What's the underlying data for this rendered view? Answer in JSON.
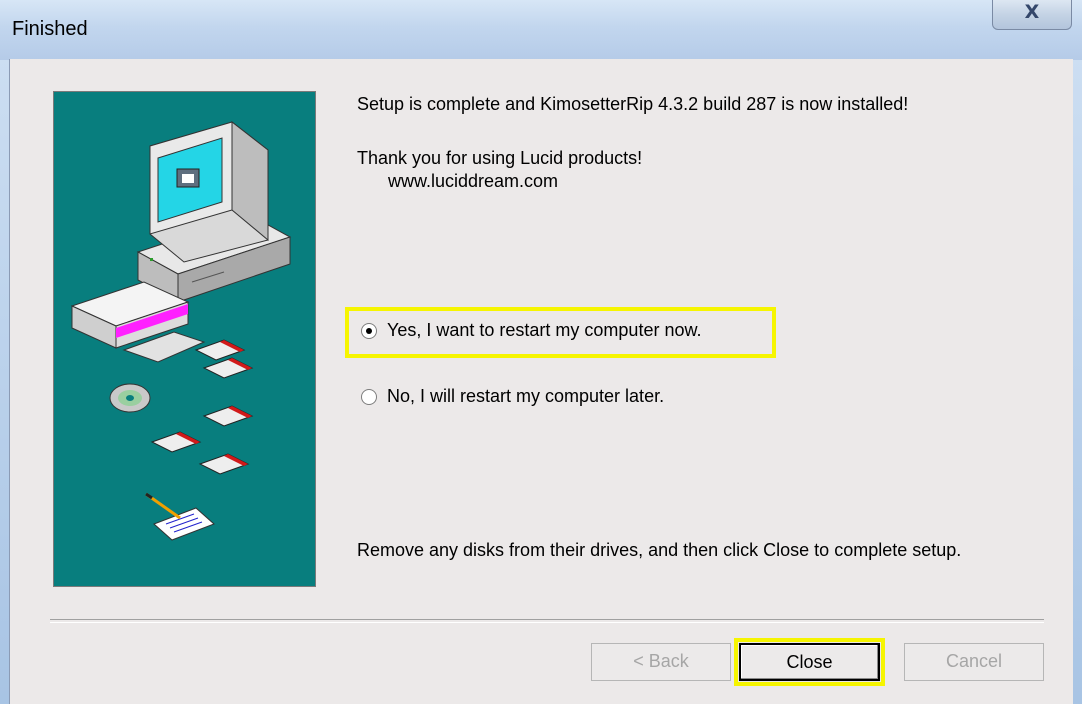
{
  "window": {
    "title": "Finished",
    "close_glyph": "X"
  },
  "content": {
    "line1": "Setup is complete and KimosetterRip 4.3.2 build 287 is now installed!",
    "line2": "Thank you for using Lucid products!",
    "line3": "www.luciddream.com",
    "radio_yes": "Yes, I want to restart my computer now.",
    "radio_no": "No, I will restart my computer later.",
    "radio_selected": "yes",
    "instructions": "Remove any disks from their drives, and then click Close to complete setup."
  },
  "buttons": {
    "back": "< Back",
    "close": "Close",
    "cancel": "Cancel"
  },
  "colors": {
    "art_background": "#087e7e",
    "highlight": "#f6f500",
    "dialog_background": "#ece9e9"
  },
  "icons": [
    "computer-illustration-icon",
    "radio-icon"
  ]
}
